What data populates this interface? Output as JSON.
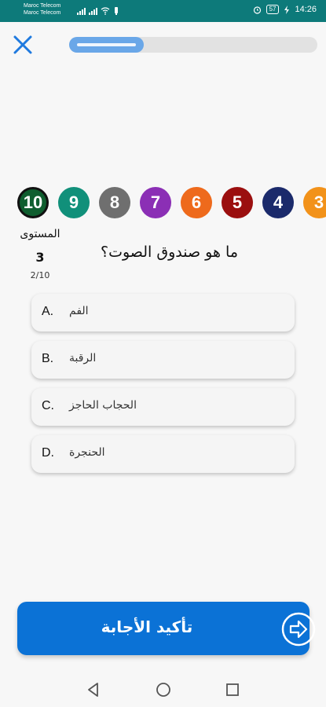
{
  "status_bar": {
    "carrier_1": "Maroc Telecom",
    "carrier_2": "Maroc Telecom",
    "battery": "57",
    "time": "14:26"
  },
  "progress": {
    "fraction": 0.3
  },
  "levels": [
    {
      "number": "10",
      "color": "#0f5e2f",
      "active": true
    },
    {
      "number": "9",
      "color": "#11907a",
      "active": false
    },
    {
      "number": "8",
      "color": "#6f6f6f",
      "active": false
    },
    {
      "number": "7",
      "color": "#8b2fb5",
      "active": false
    },
    {
      "number": "6",
      "color": "#ee6a1c",
      "active": false
    },
    {
      "number": "5",
      "color": "#9b0f0f",
      "active": false
    },
    {
      "number": "4",
      "color": "#1b2a6b",
      "active": false
    },
    {
      "number": "3",
      "color": "#f2921a",
      "active": false
    }
  ],
  "level_info": {
    "label": "المستوى",
    "number": "3",
    "question_count": "2/10"
  },
  "question": "ما هو صندوق الصوت؟",
  "options": [
    {
      "letter": "A.",
      "text": "الفم"
    },
    {
      "letter": "B.",
      "text": "الرقبة"
    },
    {
      "letter": "C.",
      "text": "الحجاب الحاجز"
    },
    {
      "letter": "D.",
      "text": "الحنجرة"
    }
  ],
  "confirm_button": {
    "label": "تأكيد الأجابة"
  },
  "colors": {
    "accent": "#0b72d6",
    "status_bar": "#0d7a7a",
    "progress_fill": "#6aa7e8"
  }
}
